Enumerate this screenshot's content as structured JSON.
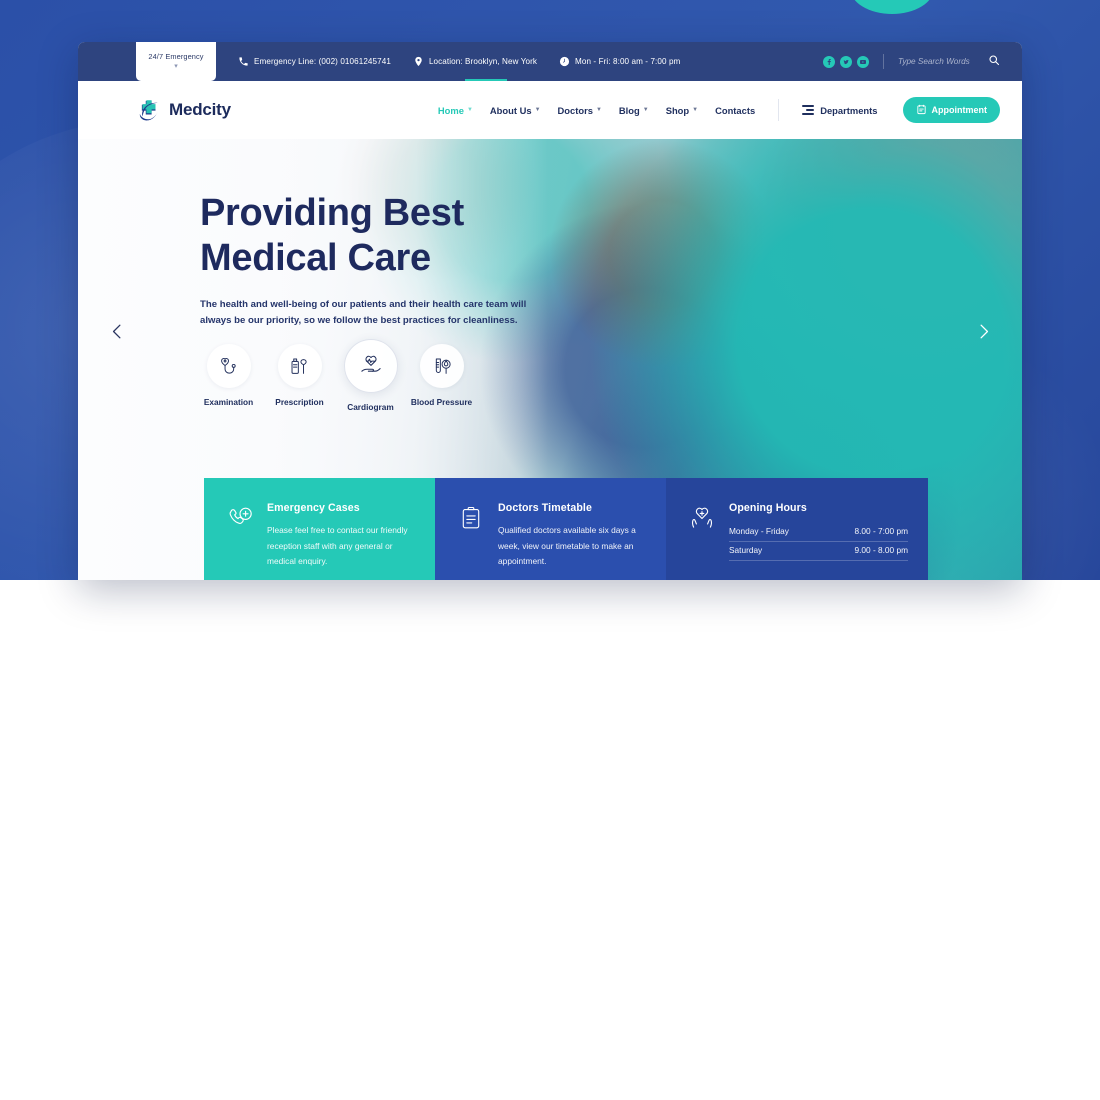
{
  "topbar": {
    "emergency_tab": {
      "label": "24/7 Emergency",
      "caret": "chevron-down-icon"
    },
    "items": [
      {
        "icon": "phone-icon",
        "text": "Emergency Line: (002) 01061245741"
      },
      {
        "icon": "location-pin-icon",
        "text": "Location: Brooklyn, New York"
      },
      {
        "icon": "clock-icon",
        "text": "Mon - Fri: 8:00 am - 7:00 pm"
      }
    ],
    "socials": [
      {
        "name": "facebook-icon",
        "label": "f"
      },
      {
        "name": "twitter-icon",
        "label": "t"
      },
      {
        "name": "youtube-icon",
        "label": "y"
      }
    ],
    "search": {
      "placeholder": "Type Search Words",
      "value": ""
    },
    "accent_color": "#25c9b7",
    "background_color": "#2e447f"
  },
  "header": {
    "logo_text": "Medcity",
    "nav": [
      {
        "label": "Home",
        "has_caret": true,
        "active": true
      },
      {
        "label": "About Us",
        "has_caret": true,
        "active": false
      },
      {
        "label": "Doctors",
        "has_caret": true,
        "active": false
      },
      {
        "label": "Blog",
        "has_caret": true,
        "active": false
      },
      {
        "label": "Shop",
        "has_caret": true,
        "active": false
      },
      {
        "label": "Contacts",
        "has_caret": false,
        "active": false
      }
    ],
    "departments_label": "Departments",
    "appointment_label": "Appointment"
  },
  "hero": {
    "title_line1": "Providing Best",
    "title_line2": "Medical Care",
    "subtitle": "The health and well-being of our patients and their health care team will always be our priority, so we follow the best practices for cleanliness.",
    "services": [
      {
        "label": "Examination",
        "icon": "examination-icon",
        "active": false
      },
      {
        "label": "Prescription",
        "icon": "prescription-icon",
        "active": false
      },
      {
        "label": "Cardiogram",
        "icon": "cardiogram-icon",
        "active": true
      },
      {
        "label": "Blood Pressure",
        "icon": "blood-pressure-icon",
        "active": false
      }
    ],
    "prev_arrow": "chevron-left-icon",
    "next_arrow": "chevron-right-icon"
  },
  "info_cards": {
    "emergency": {
      "title": "Emergency Cases",
      "text": "Please feel free to contact our friendly reception staff with any general or medical enquiry.",
      "icon": "emergency-call-icon",
      "color": "#25c9b7"
    },
    "timetable": {
      "title": "Doctors Timetable",
      "text": "Qualified doctors available six days a week, view our timetable to make an appointment.",
      "icon": "clipboard-icon",
      "color": "#2b4fae"
    },
    "hours": {
      "title": "Opening Hours",
      "icon": "heart-hands-icon",
      "color": "#26459b",
      "rows": [
        {
          "day": "Monday - Friday",
          "time": "8.00 - 7:00 pm"
        },
        {
          "day": "Saturday",
          "time": "9.00 - 8.00 pm"
        }
      ]
    }
  }
}
